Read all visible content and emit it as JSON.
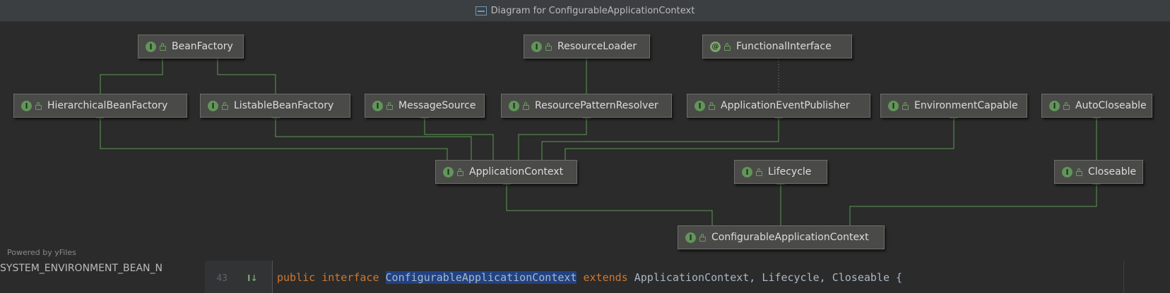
{
  "window": {
    "title": "Diagram for ConfigurableApplicationContext"
  },
  "diagram": {
    "nodes": {
      "bean_factory": {
        "kind": "I",
        "label": "BeanFactory"
      },
      "resource_loader": {
        "kind": "I",
        "label": "ResourceLoader"
      },
      "functional_interface": {
        "kind": "@",
        "label": "FunctionalInterface"
      },
      "hierarchical_bean_factory": {
        "kind": "I",
        "label": "HierarchicalBeanFactory"
      },
      "listable_bean_factory": {
        "kind": "I",
        "label": "ListableBeanFactory"
      },
      "message_source": {
        "kind": "I",
        "label": "MessageSource"
      },
      "resource_pattern_resolver": {
        "kind": "I",
        "label": "ResourcePatternResolver"
      },
      "application_event_publisher": {
        "kind": "I",
        "label": "ApplicationEventPublisher"
      },
      "environment_capable": {
        "kind": "I",
        "label": "EnvironmentCapable"
      },
      "auto_closeable": {
        "kind": "I",
        "label": "AutoCloseable"
      },
      "application_context": {
        "kind": "I",
        "label": "ApplicationContext"
      },
      "lifecycle": {
        "kind": "I",
        "label": "Lifecycle"
      },
      "closeable": {
        "kind": "I",
        "label": "Closeable"
      },
      "configurable_application_context": {
        "kind": "I",
        "label": "ConfigurableApplicationContext"
      }
    },
    "edge_colors": {
      "extends": "#5e9a55",
      "annotation": "#8a8a8a"
    }
  },
  "footer": {
    "powered_by": "Powered by yFiles"
  },
  "editor": {
    "truncated_text": "SYSTEM_ENVIRONMENT_BEAN_N",
    "line_number": "43",
    "gutter_icon": "I↓",
    "code": {
      "kw_public": "public",
      "kw_interface": "interface",
      "name_selected": "ConfigurableApplicationContext",
      "kw_extends": "extends",
      "rest": "ApplicationContext, Lifecycle, Closeable {"
    }
  }
}
